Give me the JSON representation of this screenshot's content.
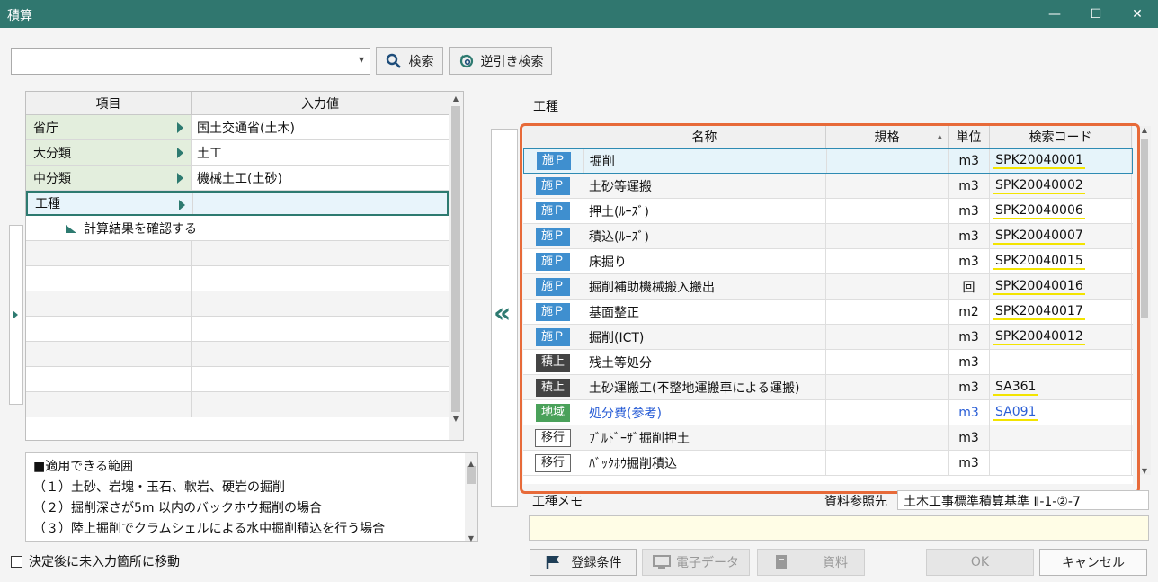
{
  "window": {
    "title": "積算",
    "minimize": "—",
    "maximize": "☐",
    "close": "✕"
  },
  "toolbar": {
    "search_value": "",
    "search_label": "検索",
    "reverse_label": "逆引き検索"
  },
  "left_grid": {
    "headers": [
      "項目",
      "入力値"
    ],
    "rows": [
      {
        "label": "省庁",
        "value": "国土交通省(土木)"
      },
      {
        "label": "大分類",
        "value": "土工"
      },
      {
        "label": "中分類",
        "value": "機械土工(土砂)"
      },
      {
        "label": "工種",
        "value": ""
      }
    ],
    "confirm_label": "計算結果を確認する"
  },
  "memo_left": {
    "lines": [
      "■適用できる範囲",
      "（１）土砂、岩塊・玉石、軟岩、硬岩の掘削",
      "（２）掘削深さが5m 以内のバックホウ掘削の場合",
      "（３）陸上掘削でクラムシェルによる水中掘削積込を行う場合"
    ]
  },
  "move_checkbox": {
    "label": "決定後に未入力箇所に移動",
    "checked": false
  },
  "collapse_glyph": "«",
  "right": {
    "section_title": "工種",
    "headers": [
      "名称",
      "規格",
      "単位",
      "検索コード"
    ],
    "rows": [
      {
        "badge": "施Ｐ",
        "kind": "blue",
        "name": "掘削",
        "spec": "",
        "unit": "m3",
        "code": "SPK20040001"
      },
      {
        "badge": "施Ｐ",
        "kind": "blue",
        "name": "土砂等運搬",
        "spec": "",
        "unit": "m3",
        "code": "SPK20040002"
      },
      {
        "badge": "施Ｐ",
        "kind": "blue",
        "name": "押土(ﾙｰｽﾞ)",
        "spec": "",
        "unit": "m3",
        "code": "SPK20040006"
      },
      {
        "badge": "施Ｐ",
        "kind": "blue",
        "name": "積込(ﾙｰｽﾞ)",
        "spec": "",
        "unit": "m3",
        "code": "SPK20040007"
      },
      {
        "badge": "施Ｐ",
        "kind": "blue",
        "name": "床掘り",
        "spec": "",
        "unit": "m3",
        "code": "SPK20040015"
      },
      {
        "badge": "施Ｐ",
        "kind": "blue",
        "name": "掘削補助機械搬入搬出",
        "spec": "",
        "unit": "回",
        "code": "SPK20040016"
      },
      {
        "badge": "施Ｐ",
        "kind": "blue",
        "name": "基面整正",
        "spec": "",
        "unit": "m2",
        "code": "SPK20040017"
      },
      {
        "badge": "施Ｐ",
        "kind": "blue",
        "name": "掘削(ICT)",
        "spec": "",
        "unit": "m3",
        "code": "SPK20040012"
      },
      {
        "badge": "積上",
        "kind": "dark",
        "name": "残土等処分",
        "spec": "",
        "unit": "m3",
        "code": ""
      },
      {
        "badge": "積上",
        "kind": "dark",
        "name": "土砂運搬工(不整地運搬車による運搬)",
        "spec": "",
        "unit": "m3",
        "code": "SA361"
      },
      {
        "badge": "地域",
        "kind": "green",
        "name": "処分費(参考)",
        "spec": "",
        "unit": "m3",
        "code": "SA091"
      },
      {
        "badge": "移行",
        "kind": "out",
        "name": "ﾌﾞﾙﾄﾞｰｻﾞ掘削押土",
        "spec": "",
        "unit": "m3",
        "code": ""
      },
      {
        "badge": "移行",
        "kind": "out",
        "name": "ﾊﾞｯｸﾎｳ掘削積込",
        "spec": "",
        "unit": "m3",
        "code": ""
      }
    ],
    "memo_label": "工種メモ",
    "ref_label": "資料参照先",
    "ref_value": "土木工事標準積算基準 Ⅱ-1-②-7"
  },
  "buttons": {
    "register": "登録条件",
    "edata": "電子データ",
    "material": "資料",
    "ok": "OK",
    "cancel": "キャンセル"
  },
  "colors": {
    "title": "#30776f",
    "accent_blue": "#3f8fcf",
    "highlight": "#e76a39"
  }
}
